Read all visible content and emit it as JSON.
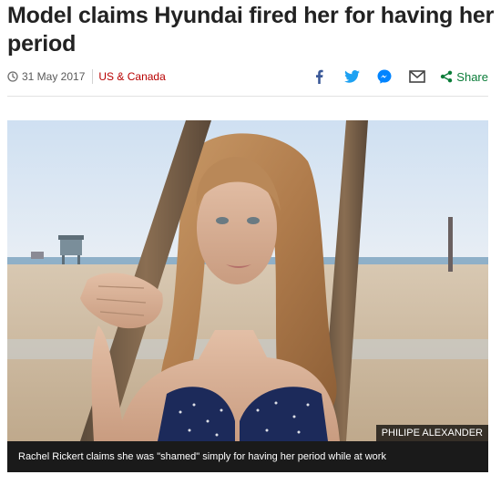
{
  "article": {
    "headline": "Model claims Hyundai fired her for having her period",
    "date": "31 May 2017",
    "section": "US & Canada"
  },
  "share": {
    "label": "Share",
    "icons": [
      "facebook-icon",
      "twitter-icon",
      "messenger-icon",
      "email-icon",
      "share-icon"
    ]
  },
  "image": {
    "credit": "PHILIPE ALEXANDER",
    "caption": "Rachel Rickert claims she was \"shamed\" simply for having her period while at work"
  },
  "colors": {
    "section_link": "#b80000",
    "share_green": "#0a7c38",
    "facebook": "#3b5998",
    "twitter": "#1da1f2",
    "messenger": "#0084ff"
  }
}
